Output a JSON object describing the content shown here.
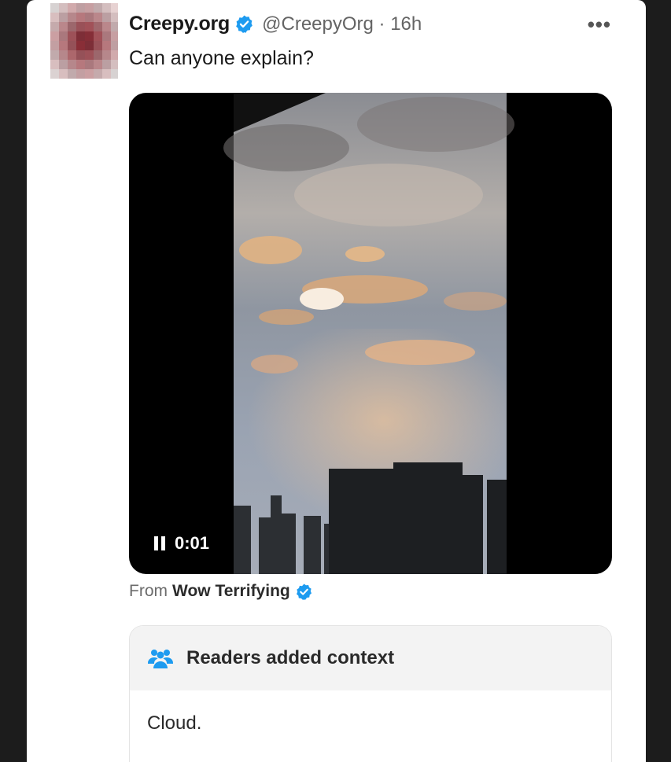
{
  "tweet": {
    "author_name": "Creepy.org",
    "handle_time": "@CreepyOrg · 16h",
    "more_label": "•••",
    "text": "Can anyone explain?",
    "icons": {
      "verified": "verified-badge-icon",
      "more": "more-options-icon",
      "pause": "pause-icon",
      "readers": "people-icon"
    }
  },
  "video": {
    "timestamp": "0:01"
  },
  "attribution": {
    "from_label": "From",
    "source_name": "Wow Terrifying"
  },
  "community_note": {
    "title": "Readers added context",
    "body": "Cloud."
  },
  "colors": {
    "verified_blue": "#1d9bf0",
    "avatar_red": "#8b1c25"
  }
}
